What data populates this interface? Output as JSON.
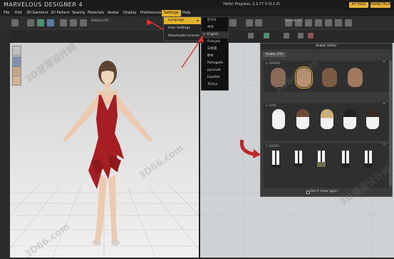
{
  "window": {
    "title": "MARVELOUS DESIGNER 4",
    "info": "Hello!     Progress:  2.1.77     0  (0.1.0)",
    "buttons": [
      "MY PAGE",
      "MARKETPLACE"
    ]
  },
  "menubar": {
    "items": [
      "File",
      "Edit",
      "3D Garment",
      "2D Pattern",
      "Sewing",
      "Materials",
      "Avatar",
      "Display",
      "Preferences",
      "Settings",
      "Help"
    ],
    "active": "Settings"
  },
  "viewports": {
    "tab_3d": "Default (3F)",
    "tab_2d": "Default (2F)"
  },
  "settings_menu": {
    "items": [
      "Language",
      "User Settings",
      "Deactivate License"
    ],
    "highlighted": "Language"
  },
  "language_menu": {
    "items": [
      "한국어",
      "中文",
      "English",
      "Français",
      "日本語",
      "हिन्दी",
      "Português",
      "русский",
      "Español",
      "Türkçe"
    ],
    "checked": "English"
  },
  "avatar_editor": {
    "title": "Avatar Editor",
    "tab": "Avatar (F5)",
    "sections": [
      {
        "label": "1. AVATAR"
      },
      {
        "label": "2. HAIR"
      },
      {
        "label": "3. SHOES"
      }
    ],
    "checkbox_label": "Don't show again"
  },
  "colors": {
    "accent": "#e4b12c",
    "dress": "#a51e24",
    "annotation_arrow": "#e03030"
  },
  "watermarks": [
    "3D66.com",
    "3D溜溜设计网"
  ]
}
